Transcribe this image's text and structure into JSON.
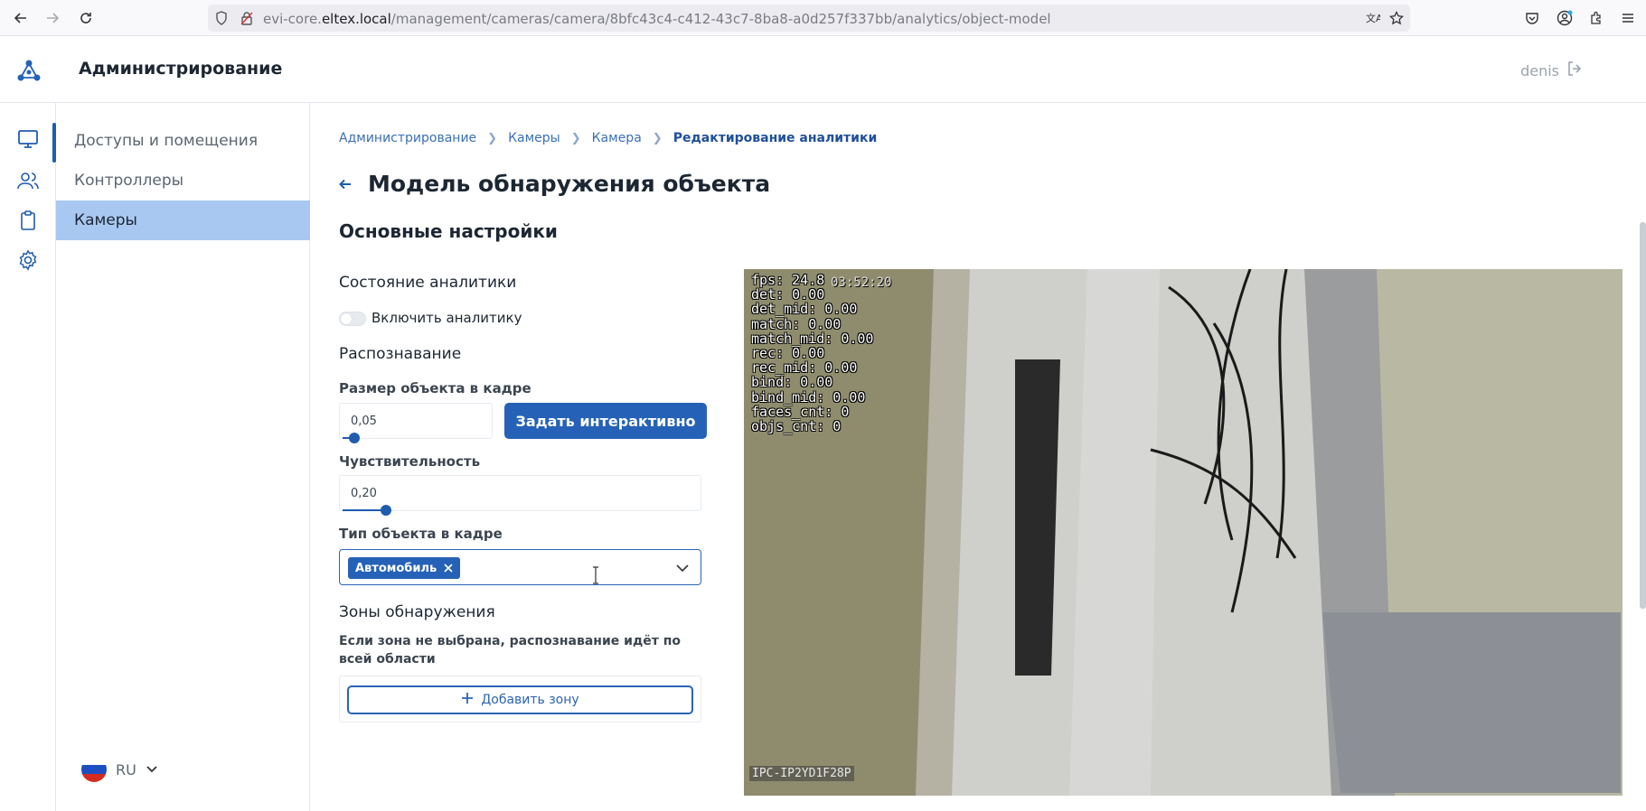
{
  "browser": {
    "url_host_prefix": "evi-core.",
    "url_host": "eltex.local",
    "url_path": "/management/cameras/camera/8bfc43c4-c412-43c7-8ba8-a0d257f337bb/analytics/object-model"
  },
  "header": {
    "title": "Администрирование",
    "user": "denis"
  },
  "sidebar": {
    "items": [
      {
        "label": "Доступы и помещения"
      },
      {
        "label": "Контроллеры"
      },
      {
        "label": "Камеры"
      }
    ],
    "language": "RU"
  },
  "breadcrumb": [
    "Администрирование",
    "Камеры",
    "Камера",
    "Редактирование аналитики"
  ],
  "page": {
    "title": "Модель обнаружения объекта",
    "section": "Основные настройки",
    "analytics_state": "Состояние аналитики",
    "toggle_label": "Включить аналитику",
    "toggle_on": false,
    "recognition": "Распознавание",
    "object_size_label": "Размер объекта в кадре",
    "object_size_value": "0,05",
    "interactive_button": "Задать интерактивно",
    "sensitivity_label": "Чувствительность",
    "sensitivity_value": "0,20",
    "object_type_label": "Тип объекта в кадре",
    "object_type_chip": "Автомобиль",
    "zones_title": "Зоны обнаружения",
    "zones_hint": "Если зона не выбрана, распознавание идёт по всей области",
    "add_zone_button": "Добавить зону"
  },
  "video": {
    "osd_lines": "fps: 24.8\ndet: 0.00\ndet_mid: 0.00\nmatch: 0.00\nmatch_mid: 0.00\nrec: 0.00\nrec_mid: 0.00\nbind: 0.00\nbind_mid: 0.00\nfaces_cnt: 0\nobjs_cnt: 0",
    "time": "03:52:20",
    "camera_name": "IPC-IP2YD1F28P"
  },
  "colors": {
    "accent": "#2562b7",
    "active_menu": "#a9c8f1"
  }
}
